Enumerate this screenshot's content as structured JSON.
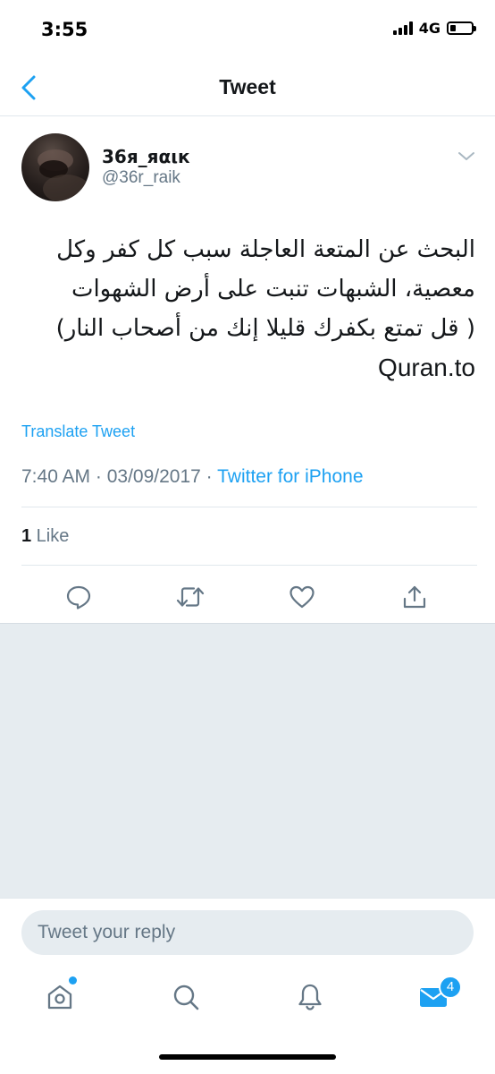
{
  "status_bar": {
    "time": "3:55",
    "network": "4G"
  },
  "nav": {
    "title": "Tweet",
    "back_icon": "chevron-left-icon"
  },
  "tweet": {
    "display_name": "36я_яαιк",
    "handle": "@36r_raik",
    "text_lines": [
      "البحث عن المتعة العاجلة سبب كل كفر وكل",
      "معصية، الشبهات تنبت على أرض الشهوات",
      "( قل تمتع بكفرك قليلا إنك من أصحاب النار)"
    ],
    "link": "Quran.to",
    "translate_label": "Translate Tweet",
    "timestamp": "7:40 AM · 03/09/2017 · ",
    "source": "Twitter for iPhone",
    "like_count": "1",
    "like_label": " Like",
    "actions": [
      "reply-icon",
      "retweet-icon",
      "like-icon",
      "share-icon"
    ]
  },
  "reply": {
    "placeholder": "Tweet your reply"
  },
  "tab_bar": {
    "tabs": [
      "home-icon",
      "search-icon",
      "notifications-icon",
      "messages-icon"
    ],
    "messages_badge": "4"
  },
  "colors": {
    "accent": "#1da1f2",
    "secondary_text": "#657786",
    "gray_background": "#e6ecf0"
  }
}
